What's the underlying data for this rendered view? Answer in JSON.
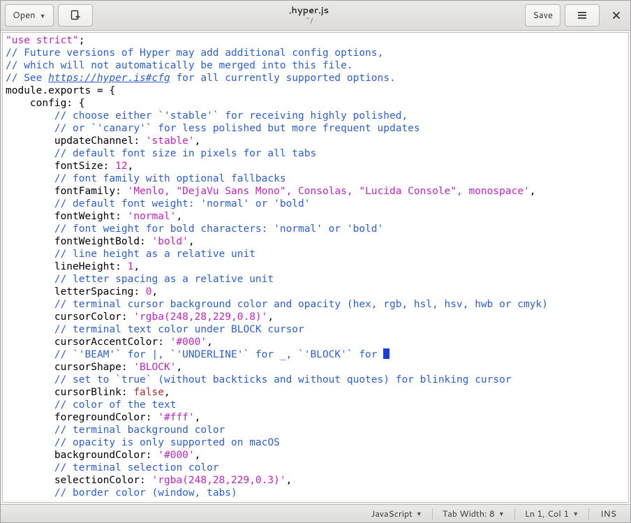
{
  "header": {
    "open_label": "Open",
    "save_label": "Save",
    "title": ".hyper.js",
    "subtitle": "~/"
  },
  "statusbar": {
    "language": "JavaScript",
    "tab_width": "Tab Width: 8",
    "position": "Ln 1, Col 1",
    "ins": "INS"
  },
  "code": {
    "lines": [
      {
        "segs": [
          {
            "t": "\"use strict\"",
            "c": "tok-str"
          },
          {
            "t": ";"
          }
        ]
      },
      {
        "segs": [
          {
            "t": "// Future versions of Hyper may add additional config options,",
            "c": "tok-com"
          }
        ]
      },
      {
        "segs": [
          {
            "t": "// which will not automatically be merged into this file.",
            "c": "tok-com"
          }
        ]
      },
      {
        "segs": [
          {
            "t": "// See ",
            "c": "tok-com"
          },
          {
            "t": "https://hyper.is#cfg",
            "c": "tok-link"
          },
          {
            "t": " for all currently supported options.",
            "c": "tok-com"
          }
        ]
      },
      {
        "segs": [
          {
            "t": "module.exports = {"
          }
        ]
      },
      {
        "segs": [
          {
            "t": "    config: {"
          }
        ]
      },
      {
        "segs": [
          {
            "t": "        "
          },
          {
            "t": "// choose either `'stable'` for receiving highly polished,",
            "c": "tok-com"
          }
        ]
      },
      {
        "segs": [
          {
            "t": "        "
          },
          {
            "t": "// or `'canary'` for less polished but more frequent updates",
            "c": "tok-com"
          }
        ]
      },
      {
        "segs": [
          {
            "t": "        updateChannel: "
          },
          {
            "t": "'stable'",
            "c": "tok-str"
          },
          {
            "t": ","
          }
        ]
      },
      {
        "segs": [
          {
            "t": "        "
          },
          {
            "t": "// default font size in pixels for all tabs",
            "c": "tok-com"
          }
        ]
      },
      {
        "segs": [
          {
            "t": "        fontSize: "
          },
          {
            "t": "12",
            "c": "tok-num"
          },
          {
            "t": ","
          }
        ]
      },
      {
        "segs": [
          {
            "t": "        "
          },
          {
            "t": "// font family with optional fallbacks",
            "c": "tok-com"
          }
        ]
      },
      {
        "segs": [
          {
            "t": "        fontFamily: "
          },
          {
            "t": "'Menlo, \"DejaVu Sans Mono\", Consolas, \"Lucida Console\", monospace'",
            "c": "tok-str"
          },
          {
            "t": ","
          }
        ]
      },
      {
        "segs": [
          {
            "t": "        "
          },
          {
            "t": "// default font weight: 'normal' or 'bold'",
            "c": "tok-com"
          }
        ]
      },
      {
        "segs": [
          {
            "t": "        fontWeight: "
          },
          {
            "t": "'normal'",
            "c": "tok-str"
          },
          {
            "t": ","
          }
        ]
      },
      {
        "segs": [
          {
            "t": "        "
          },
          {
            "t": "// font weight for bold characters: 'normal' or 'bold'",
            "c": "tok-com"
          }
        ]
      },
      {
        "segs": [
          {
            "t": "        fontWeightBold: "
          },
          {
            "t": "'bold'",
            "c": "tok-str"
          },
          {
            "t": ","
          }
        ]
      },
      {
        "segs": [
          {
            "t": "        "
          },
          {
            "t": "// line height as a relative unit",
            "c": "tok-com"
          }
        ]
      },
      {
        "segs": [
          {
            "t": "        lineHeight: "
          },
          {
            "t": "1",
            "c": "tok-num"
          },
          {
            "t": ","
          }
        ]
      },
      {
        "segs": [
          {
            "t": "        "
          },
          {
            "t": "// letter spacing as a relative unit",
            "c": "tok-com"
          }
        ]
      },
      {
        "segs": [
          {
            "t": "        letterSpacing: "
          },
          {
            "t": "0",
            "c": "tok-num"
          },
          {
            "t": ","
          }
        ]
      },
      {
        "segs": [
          {
            "t": "        "
          },
          {
            "t": "// terminal cursor background color and opacity (hex, rgb, hsl, hsv, hwb or cmyk)",
            "c": "tok-com"
          }
        ]
      },
      {
        "segs": [
          {
            "t": "        cursorColor: "
          },
          {
            "t": "'rgba(248,28,229,0.8)'",
            "c": "tok-str"
          },
          {
            "t": ","
          }
        ]
      },
      {
        "segs": [
          {
            "t": "        "
          },
          {
            "t": "// terminal text color under BLOCK cursor",
            "c": "tok-com"
          }
        ]
      },
      {
        "segs": [
          {
            "t": "        cursorAccentColor: "
          },
          {
            "t": "'#000'",
            "c": "tok-str"
          },
          {
            "t": ","
          }
        ]
      },
      {
        "segs": [
          {
            "t": "        "
          },
          {
            "t": "// `'BEAM'` for |, `'UNDERLINE'` for _, `'BLOCK'` for ",
            "c": "tok-com"
          },
          {
            "t": "",
            "c": "cursor-block"
          }
        ]
      },
      {
        "segs": [
          {
            "t": "        cursorShape: "
          },
          {
            "t": "'BLOCK'",
            "c": "tok-str"
          },
          {
            "t": ","
          }
        ]
      },
      {
        "segs": [
          {
            "t": "        "
          },
          {
            "t": "// set to `true` (without backticks and without quotes) for blinking cursor",
            "c": "tok-com"
          }
        ]
      },
      {
        "segs": [
          {
            "t": "        cursorBlink: "
          },
          {
            "t": "false",
            "c": "tok-bool"
          },
          {
            "t": ","
          }
        ]
      },
      {
        "segs": [
          {
            "t": "        "
          },
          {
            "t": "// color of the text",
            "c": "tok-com"
          }
        ]
      },
      {
        "segs": [
          {
            "t": "        foregroundColor: "
          },
          {
            "t": "'#fff'",
            "c": "tok-str"
          },
          {
            "t": ","
          }
        ]
      },
      {
        "segs": [
          {
            "t": "        "
          },
          {
            "t": "// terminal background color",
            "c": "tok-com"
          }
        ]
      },
      {
        "segs": [
          {
            "t": "        "
          },
          {
            "t": "// opacity is only supported on macOS",
            "c": "tok-com"
          }
        ]
      },
      {
        "segs": [
          {
            "t": "        backgroundColor: "
          },
          {
            "t": "'#000'",
            "c": "tok-str"
          },
          {
            "t": ","
          }
        ]
      },
      {
        "segs": [
          {
            "t": "        "
          },
          {
            "t": "// terminal selection color",
            "c": "tok-com"
          }
        ]
      },
      {
        "segs": [
          {
            "t": "        selectionColor: "
          },
          {
            "t": "'rgba(248,28,229,0.3)'",
            "c": "tok-str"
          },
          {
            "t": ","
          }
        ]
      },
      {
        "segs": [
          {
            "t": "        "
          },
          {
            "t": "// border color (window, tabs)",
            "c": "tok-com"
          }
        ]
      }
    ]
  }
}
